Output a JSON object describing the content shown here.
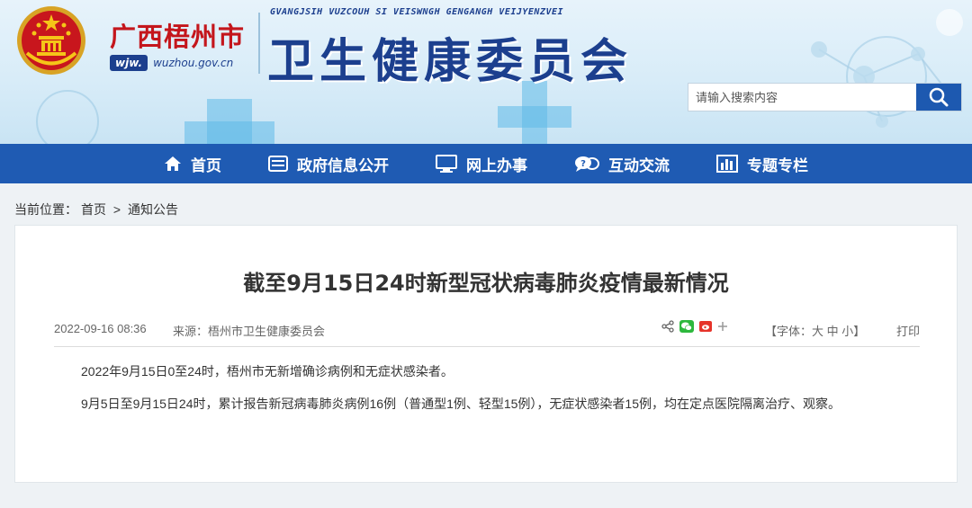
{
  "header": {
    "city_name": "广西梧州市",
    "url_short": "wjw.",
    "url_long": "wuzhou.gov.cn",
    "zhuang_name": "GVANGJSIH VUZCOUH SI VEISWNGH GENGANGH VEIJYENZVEI",
    "org_name": "卫生健康委员会"
  },
  "search": {
    "placeholder": "请输入搜索内容"
  },
  "nav": {
    "items": [
      {
        "label": "首页",
        "icon": "home-icon"
      },
      {
        "label": "政府信息公开",
        "icon": "info-box-icon"
      },
      {
        "label": "网上办事",
        "icon": "monitor-icon"
      },
      {
        "label": "互动交流",
        "icon": "chat-icon"
      },
      {
        "label": "专题专栏",
        "icon": "bar-chart-icon"
      }
    ]
  },
  "breadcrumb": {
    "prefix": "当前位置：",
    "home": "首页",
    "separator": ">",
    "current": "通知公告"
  },
  "article": {
    "title": "截至9月15日24时新型冠状病毒肺炎疫情最新情况",
    "date": "2022-09-16 08:36",
    "source_label": "来源：",
    "source": "梧州市卫生健康委员会",
    "font_size_label": "【字体：大 中 小】",
    "print_label": "打印",
    "paragraphs": [
      "2022年9月15日0至24时，梧州市无新增确诊病例和无症状感染者。",
      "9月5日至9月15日24时，累计报告新冠病毒肺炎病例16例（普通型1例、轻型15例），无症状感染者15例，均在定点医院隔离治疗、观察。"
    ]
  },
  "colors": {
    "brand_blue": "#1f5bb3",
    "emblem_red": "#c4161c",
    "title_dark": "#333333"
  }
}
